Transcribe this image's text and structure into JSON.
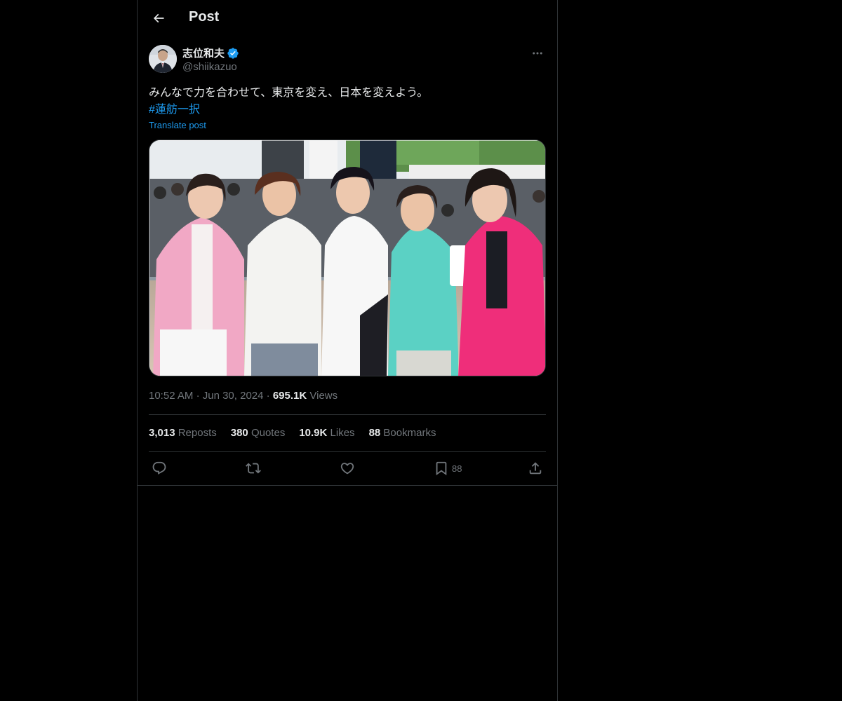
{
  "header": {
    "title": "Post",
    "back_icon": "arrow-left-icon"
  },
  "author": {
    "name": "志位和夫",
    "handle": "@shiikazuo",
    "verified": true,
    "verified_color": "#1d9bf0"
  },
  "tweet": {
    "text": "みんなで力を合わせて、東京を変え、日本を変えよう。",
    "hashtag": "#蓮舫一択",
    "translate_label": "Translate post"
  },
  "meta": {
    "time": "10:52 AM",
    "sep1": "·",
    "date": "Jun 30, 2024",
    "sep2": "·",
    "views_count": "695.1K",
    "views_label": "Views"
  },
  "stats": {
    "reposts_count": "3,013",
    "reposts_label": "Reposts",
    "quotes_count": "380",
    "quotes_label": "Quotes",
    "likes_count": "10.9K",
    "likes_label": "Likes",
    "bookmarks_count": "88",
    "bookmarks_label": "Bookmarks"
  },
  "actions": {
    "reply_icon": "reply-icon",
    "repost_icon": "repost-icon",
    "like_icon": "heart-icon",
    "bookmark_icon": "bookmark-icon",
    "bookmark_count": "88",
    "share_icon": "share-icon"
  },
  "colors": {
    "background": "#000000",
    "text_primary": "#e7e9ea",
    "text_secondary": "#71767b",
    "link": "#1d9bf0",
    "border": "#2f3336"
  }
}
